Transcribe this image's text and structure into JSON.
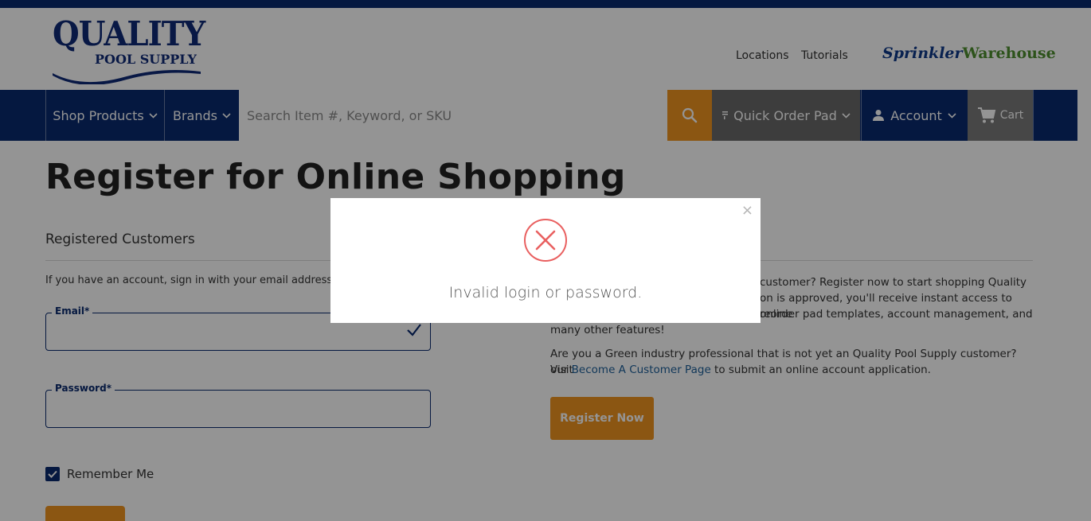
{
  "brand": {
    "logo_word1": "QUALITY",
    "logo_word2": "POOL SUPPLY",
    "partner_a": "Sprinkler",
    "partner_b": "Warehouse"
  },
  "header_links": {
    "locations": "Locations",
    "tutorials": "Tutorials"
  },
  "nav": {
    "shop_products": "Shop Products",
    "brands": "Brands",
    "search_placeholder": "Search Item #, Keyword, or SKU",
    "quick_order": "Quick Order Pad",
    "account": "Account",
    "cart": "Cart"
  },
  "page": {
    "title": "Register for Online Shopping",
    "registered_title": "Registered Customers",
    "intro": "If you have an account, sign in with your email address.",
    "email_label": "Email*",
    "password_label": "Password*",
    "remember_label": "Remember Me",
    "remember_checked": true
  },
  "right": {
    "para1_visible": "customer? Register now to start shopping Quality",
    "para1_line2": "on is approved, you'll receive instant access to online",
    "para1_line3": "reorder pad templates, account management, and",
    "para1_line4": "many other features!",
    "para2_line1": "Are you a Green industry professional that is not yet an Quality Pool Supply customer? Visit",
    "para2_prefix": "our ",
    "para2_link": "Become A Customer Page",
    "para2_suffix": " to submit an online account application.",
    "register_btn": "Register Now"
  },
  "modal": {
    "message": "Invalid login or password.",
    "close": "×"
  },
  "colors": {
    "navy": "#0a2a6e",
    "orange": "#f0951f",
    "error_red": "#e96060"
  }
}
